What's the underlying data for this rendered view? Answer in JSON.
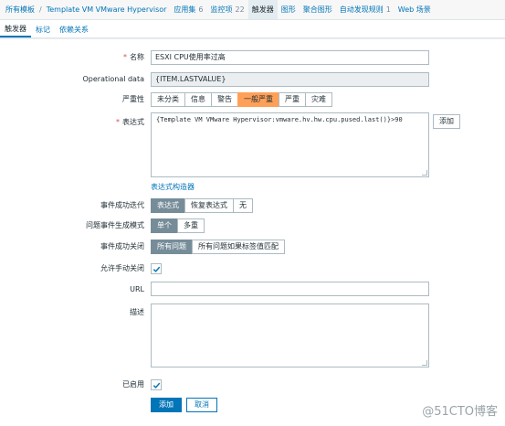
{
  "nav": {
    "all_templates": "所有模板",
    "separator": "/",
    "template": "Template VM VMware Hypervisor",
    "applications": "应用集",
    "applications_count": "6",
    "items": "监控项",
    "items_count": "22",
    "triggers": "触发器",
    "graphs": "图形",
    "screens": "聚合图形",
    "discovery": "自动发现规则",
    "discovery_count": "1",
    "web": "Web 场景"
  },
  "subtabs": {
    "trigger": "触发器",
    "tags": "标记",
    "dependencies": "依赖关系"
  },
  "form": {
    "name_label": "名称",
    "name_value": "ESXI CPU使用率过高",
    "opdata_label": "Operational data",
    "opdata_value": "{ITEM.LASTVALUE}",
    "severity_label": "严重性",
    "severity_options": [
      "未分类",
      "信息",
      "警告",
      "一般严重",
      "严重",
      "灾难"
    ],
    "severity_selected": "一般严重",
    "expression_label": "表达式",
    "expression_value": "{Template VM VMware Hypervisor:vmware.hv.hw.cpu.pused.last()}>90",
    "expression_add": "添加",
    "expression_builder": "表达式构造器",
    "ok_event_label": "事件成功迭代",
    "ok_event_options": [
      "表达式",
      "恢复表达式",
      "无"
    ],
    "ok_event_selected": "表达式",
    "problem_mode_label": "问题事件生成模式",
    "problem_mode_options": [
      "单个",
      "多重"
    ],
    "problem_mode_selected": "单个",
    "ok_close_label": "事件成功关闭",
    "ok_close_options": [
      "所有问题",
      "所有问题如果标签值匹配"
    ],
    "ok_close_selected": "所有问题",
    "manual_close_label": "允许手动关闭",
    "manual_close_checked": true,
    "url_label": "URL",
    "url_value": "",
    "description_label": "描述",
    "description_value": "",
    "enabled_label": "已启用",
    "enabled_checked": true,
    "add_button": "添加",
    "cancel_button": "取消",
    "required_mark": "*"
  },
  "watermark": "@51CTO博客",
  "colors": {
    "link": "#0275b8",
    "selected_segment": "#768d99",
    "severity_average": "#ffa059",
    "required": "#d64e4e"
  }
}
